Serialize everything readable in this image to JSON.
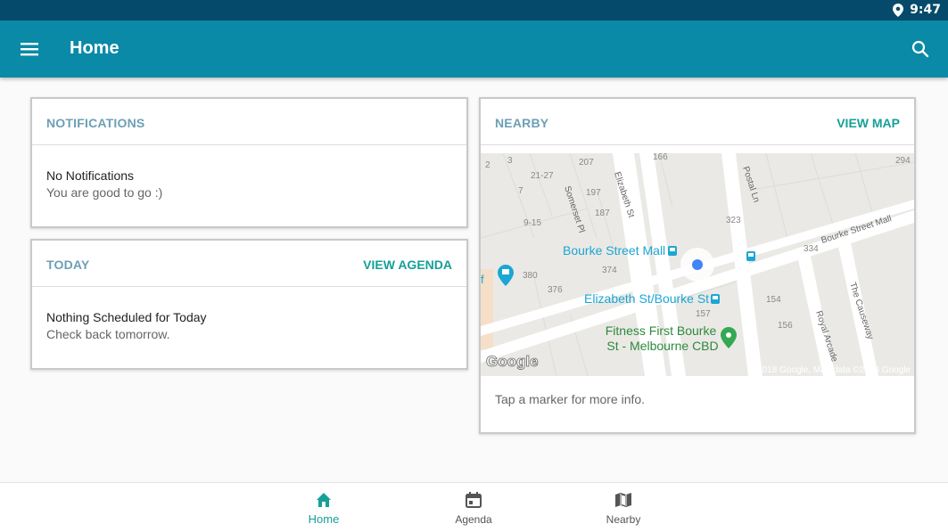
{
  "status_bar": {
    "time": "9:47",
    "location_icon": "location-pin-icon"
  },
  "app_bar": {
    "title": "Home",
    "menu_icon": "hamburger-menu-icon",
    "search_icon": "search-icon",
    "color": "#0a8aa7"
  },
  "notifications": {
    "title": "NOTIFICATIONS",
    "primary": "No Notifications",
    "secondary": "You are good to go :)"
  },
  "today": {
    "title": "TODAY",
    "action": "VIEW AGENDA",
    "primary": "Nothing Scheduled for Today",
    "secondary": "Check back tomorrow."
  },
  "nearby": {
    "title": "NEARBY",
    "action": "VIEW MAP",
    "footer": "Tap a marker for more info.",
    "map": {
      "place_labels": {
        "bourke_street_mall": "Bourke Street Mall",
        "elizabeth_bourke": "Elizabeth St/Bourke St",
        "fitness_line1": "Fitness First Bourke",
        "fitness_line2": "St - Melbourne CBD"
      },
      "street_labels": {
        "elizabeth_st": "Elizabeth St",
        "somerset_pl": "Somerset Pl",
        "postal_ln": "Postal Ln",
        "bourke_street_mall_road": "Bourke Street Mall",
        "the_causeway": "The Causeway",
        "royal_arcade": "Royal Arcade"
      },
      "numbers": {
        "n2": "2",
        "n3": "3",
        "n21_27": "21-27",
        "n207": "207",
        "n166": "166",
        "n294": "294",
        "n7": "7",
        "n197": "197",
        "n187": "187",
        "n9_15": "9-15",
        "n323": "323",
        "n374": "374",
        "n334": "334",
        "n380": "380",
        "n376": "376",
        "n154": "154",
        "n157": "157",
        "n156": "156"
      },
      "logo": "Google",
      "copyright": "©2018 Google, Map data ©2018 Google",
      "accent_blue": "#4285f4",
      "marker_green": "#34a853",
      "transit_color": "#1ba6d5"
    }
  },
  "bottom_nav": {
    "items": [
      {
        "label": "Home",
        "icon": "home-icon",
        "active": true
      },
      {
        "label": "Agenda",
        "icon": "calendar-icon",
        "active": false
      },
      {
        "label": "Nearby",
        "icon": "map-icon",
        "active": false
      }
    ],
    "active_color": "#16a097"
  }
}
